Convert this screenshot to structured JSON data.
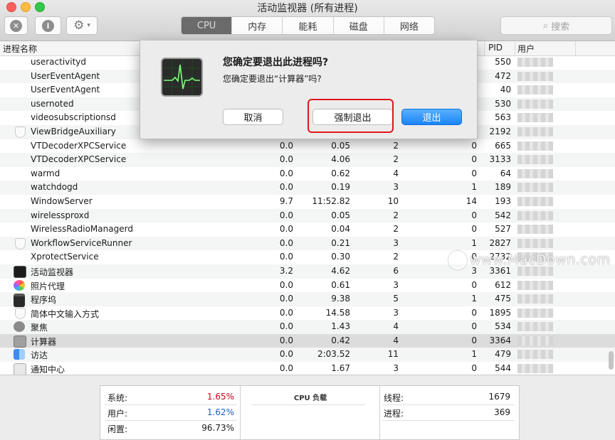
{
  "window": {
    "title": "活动监视器 (所有进程)"
  },
  "toolbar": {
    "stop_glyph": "✕",
    "info_glyph": "i",
    "gear_glyph": "⚙",
    "chevron_glyph": "▾",
    "tabs": [
      "CPU",
      "内存",
      "能耗",
      "磁盘",
      "网络"
    ],
    "active_tab": "CPU",
    "search_placeholder": "搜索",
    "search_glyph": "⌕"
  },
  "table": {
    "headers": {
      "name": "进程名称",
      "pid": "PID",
      "user": "用户"
    },
    "rows": [
      {
        "name": "useractivityd",
        "cpu": "",
        "time": "",
        "threads": "",
        "wakeups": "",
        "pid": "550",
        "icon": "none"
      },
      {
        "name": "UserEventAgent",
        "cpu": "",
        "time": "",
        "threads": "",
        "wakeups": "",
        "pid": "472",
        "icon": "none"
      },
      {
        "name": "UserEventAgent",
        "cpu": "",
        "time": "",
        "threads": "",
        "wakeups": "",
        "pid": "40",
        "icon": "none"
      },
      {
        "name": "usernoted",
        "cpu": "",
        "time": "",
        "threads": "",
        "wakeups": "",
        "pid": "530",
        "icon": "none"
      },
      {
        "name": "videosubscriptionsd",
        "cpu": "",
        "time": "",
        "threads": "",
        "wakeups": "",
        "pid": "563",
        "icon": "none"
      },
      {
        "name": "ViewBridgeAuxiliary",
        "cpu": "",
        "time": "",
        "threads": "",
        "wakeups": "",
        "pid": "2192",
        "icon": "shield"
      },
      {
        "name": "VTDecoderXPCService",
        "cpu": "0.0",
        "time": "0.05",
        "threads": "2",
        "wakeups": "0",
        "pid": "665",
        "icon": "none"
      },
      {
        "name": "VTDecoderXPCService",
        "cpu": "0.0",
        "time": "4.06",
        "threads": "2",
        "wakeups": "0",
        "pid": "3133",
        "icon": "none"
      },
      {
        "name": "warmd",
        "cpu": "0.0",
        "time": "0.62",
        "threads": "4",
        "wakeups": "0",
        "pid": "64",
        "icon": "none"
      },
      {
        "name": "watchdogd",
        "cpu": "0.0",
        "time": "0.19",
        "threads": "3",
        "wakeups": "1",
        "pid": "189",
        "icon": "none"
      },
      {
        "name": "WindowServer",
        "cpu": "9.7",
        "time": "11:52.82",
        "threads": "10",
        "wakeups": "14",
        "pid": "193",
        "icon": "none"
      },
      {
        "name": "wirelessproxd",
        "cpu": "0.0",
        "time": "0.05",
        "threads": "2",
        "wakeups": "0",
        "pid": "542",
        "icon": "none"
      },
      {
        "name": "WirelessRadioManagerd",
        "cpu": "0.0",
        "time": "0.04",
        "threads": "2",
        "wakeups": "0",
        "pid": "527",
        "icon": "none"
      },
      {
        "name": "WorkflowServiceRunner",
        "cpu": "0.0",
        "time": "0.21",
        "threads": "3",
        "wakeups": "1",
        "pid": "2827",
        "icon": "shield"
      },
      {
        "name": "XprotectService",
        "cpu": "0.0",
        "time": "0.30",
        "threads": "2",
        "wakeups": "0",
        "pid": "2732",
        "icon": "none"
      },
      {
        "name": "活动监视器",
        "cpu": "3.2",
        "time": "4.62",
        "threads": "6",
        "wakeups": "3",
        "pid": "3361",
        "icon": "monitor"
      },
      {
        "name": "照片代理",
        "cpu": "0.0",
        "time": "0.61",
        "threads": "3",
        "wakeups": "0",
        "pid": "612",
        "icon": "photos"
      },
      {
        "name": "程序坞",
        "cpu": "0.0",
        "time": "9.38",
        "threads": "5",
        "wakeups": "1",
        "pid": "475",
        "icon": "dock"
      },
      {
        "name": "简体中文输入方式",
        "cpu": "0.0",
        "time": "14.58",
        "threads": "3",
        "wakeups": "0",
        "pid": "1895",
        "icon": "shield"
      },
      {
        "name": "聚焦",
        "cpu": "0.0",
        "time": "1.43",
        "threads": "4",
        "wakeups": "0",
        "pid": "534",
        "icon": "spot"
      },
      {
        "name": "计算器",
        "cpu": "0.0",
        "time": "0.42",
        "threads": "4",
        "wakeups": "0",
        "pid": "3364",
        "icon": "calc",
        "selected": true
      },
      {
        "name": "访达",
        "cpu": "0.0",
        "time": "2:03.52",
        "threads": "11",
        "wakeups": "1",
        "pid": "479",
        "icon": "finder"
      },
      {
        "name": "通知中心",
        "cpu": "0.0",
        "time": "1.67",
        "threads": "3",
        "wakeups": "0",
        "pid": "544",
        "icon": "notif"
      }
    ]
  },
  "stats": {
    "system_label": "系统:",
    "system_value": "1.65%",
    "system_color": "#d0021b",
    "user_label": "用户:",
    "user_value": "1.62%",
    "user_color": "#1f5fbf",
    "idle_label": "闲置:",
    "idle_value": "96.73%",
    "graph_title": "CPU 负载",
    "threads_label": "线程:",
    "threads_value": "1679",
    "processes_label": "进程:",
    "processes_value": "369"
  },
  "dialog": {
    "title": "您确定要退出此进程吗?",
    "message": "您确定要退出“计算器”吗?",
    "cancel_label": "取消",
    "force_quit_label": "强制退出",
    "quit_label": "退出"
  },
  "watermark": {
    "text": "www.MacDown.com"
  }
}
